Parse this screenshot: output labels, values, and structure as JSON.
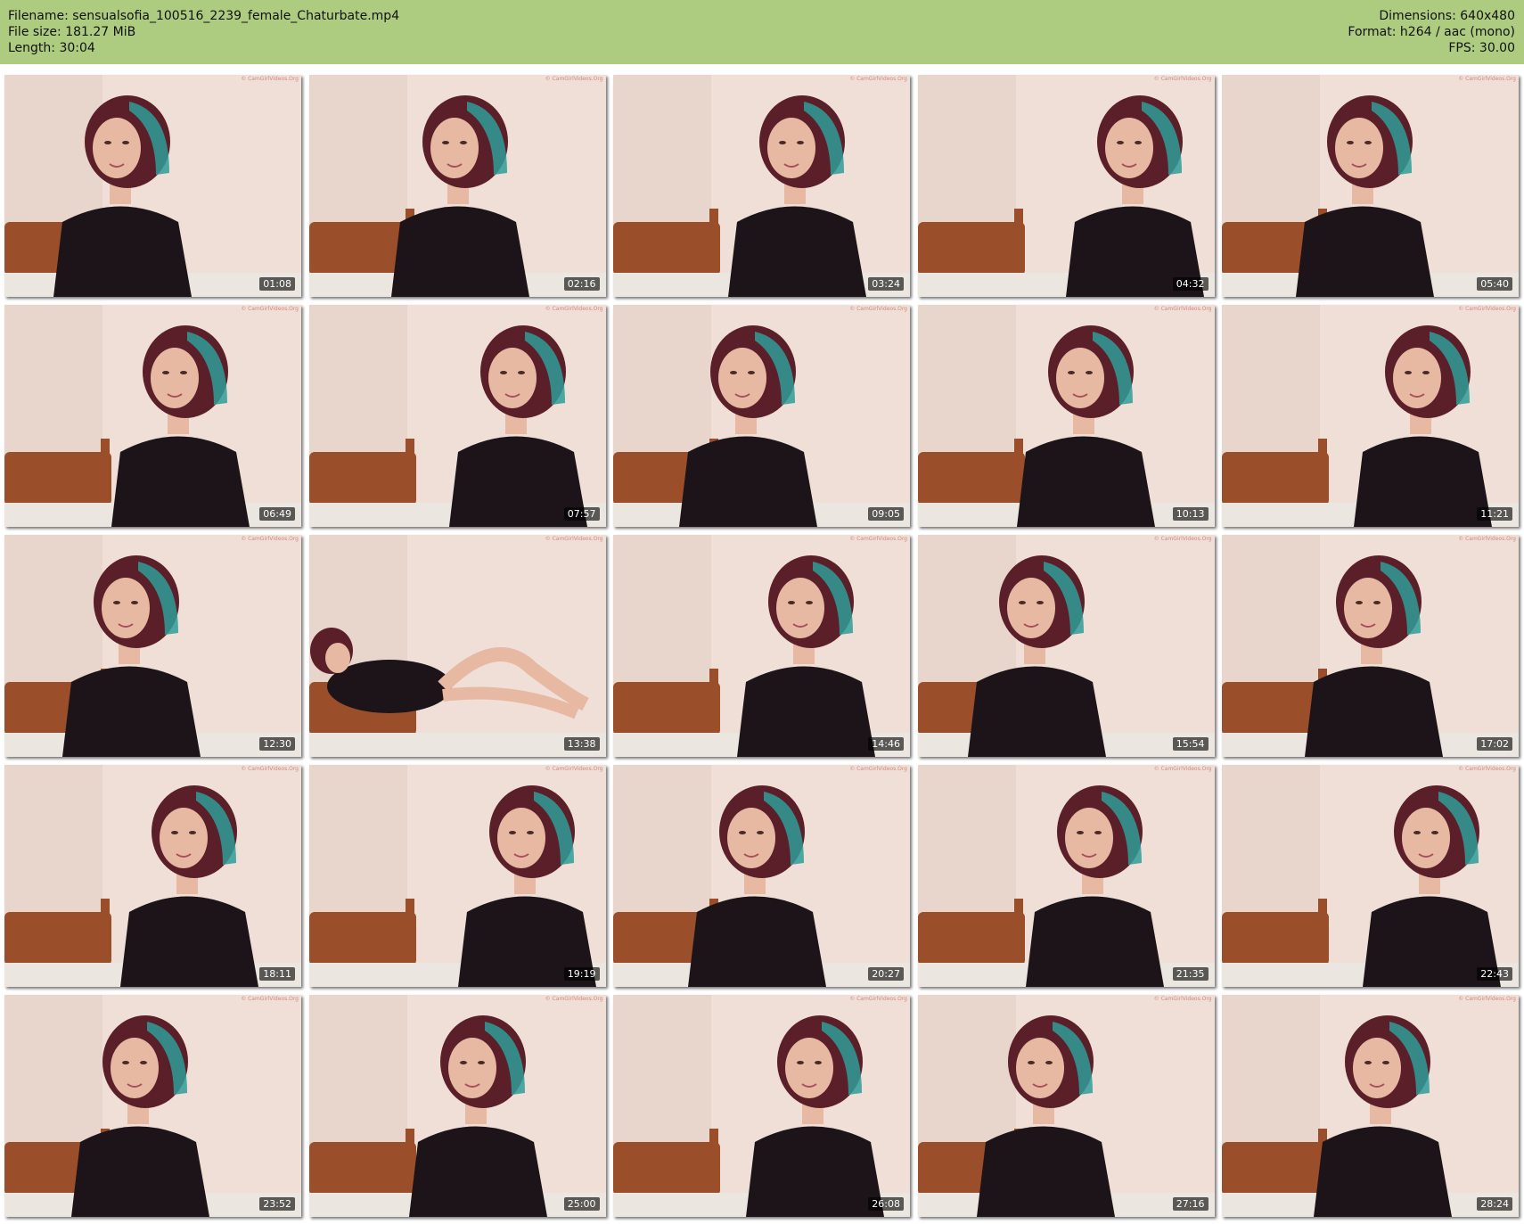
{
  "header": {
    "filename_line": "Filename: sensualsofia_100516_2239_female_Chaturbate.mp4",
    "filesize_line": "File size: 181.27 MiB",
    "length_line": "Length: 30:04",
    "dimensions_line": "Dimensions: 640x480",
    "format_line": "Format: h264 / aac (mono)",
    "fps_line": "FPS: 30.00"
  },
  "colors": {
    "header_bg": "#adcc7f",
    "wall": "#efdfd6",
    "wall_shade": "#e2cbbf",
    "bed": "#9a4e2a",
    "sheet": "#ece6e0",
    "dress": "#1c1418",
    "hair": "#5b1f2a",
    "hair_highlight": "#2f9c98",
    "skin": "#e7b8a2",
    "stamp_bg": "#000000"
  },
  "thumbnails": [
    {
      "time": "01:08",
      "alt": "video frame",
      "watermark": "© CamGirlVideos.Org"
    },
    {
      "time": "02:16",
      "alt": "video frame",
      "watermark": "© CamGirlVideos.Org"
    },
    {
      "time": "03:24",
      "alt": "video frame",
      "watermark": "© CamGirlVideos.Org"
    },
    {
      "time": "04:32",
      "alt": "video frame",
      "watermark": "© CamGirlVideos.Org"
    },
    {
      "time": "05:40",
      "alt": "video frame",
      "watermark": "© CamGirlVideos.Org"
    },
    {
      "time": "06:49",
      "alt": "video frame",
      "watermark": "© CamGirlVideos.Org"
    },
    {
      "time": "07:57",
      "alt": "video frame",
      "watermark": "© CamGirlVideos.Org"
    },
    {
      "time": "09:05",
      "alt": "video frame",
      "watermark": "© CamGirlVideos.Org"
    },
    {
      "time": "10:13",
      "alt": "video frame",
      "watermark": "© CamGirlVideos.Org"
    },
    {
      "time": "11:21",
      "alt": "video frame",
      "watermark": "© CamGirlVideos.Org"
    },
    {
      "time": "12:30",
      "alt": "video frame",
      "watermark": "© CamGirlVideos.Org"
    },
    {
      "time": "13:38",
      "alt": "video frame",
      "watermark": "© CamGirlVideos.Org"
    },
    {
      "time": "14:46",
      "alt": "video frame",
      "watermark": "© CamGirlVideos.Org"
    },
    {
      "time": "15:54",
      "alt": "video frame",
      "watermark": "© CamGirlVideos.Org"
    },
    {
      "time": "17:02",
      "alt": "video frame",
      "watermark": "© CamGirlVideos.Org"
    },
    {
      "time": "18:11",
      "alt": "video frame",
      "watermark": "© CamGirlVideos.Org"
    },
    {
      "time": "19:19",
      "alt": "video frame",
      "watermark": "© CamGirlVideos.Org"
    },
    {
      "time": "20:27",
      "alt": "video frame",
      "watermark": "© CamGirlVideos.Org"
    },
    {
      "time": "21:35",
      "alt": "video frame",
      "watermark": "© CamGirlVideos.Org"
    },
    {
      "time": "22:43",
      "alt": "video frame",
      "watermark": "© CamGirlVideos.Org"
    },
    {
      "time": "23:52",
      "alt": "video frame",
      "watermark": "© CamGirlVideos.Org"
    },
    {
      "time": "25:00",
      "alt": "video frame",
      "watermark": "© CamGirlVideos.Org"
    },
    {
      "time": "26:08",
      "alt": "video frame",
      "watermark": "© CamGirlVideos.Org"
    },
    {
      "time": "27:16",
      "alt": "video frame",
      "watermark": "© CamGirlVideos.Org"
    },
    {
      "time": "28:24",
      "alt": "video frame",
      "watermark": "© CamGirlVideos.Org"
    }
  ]
}
